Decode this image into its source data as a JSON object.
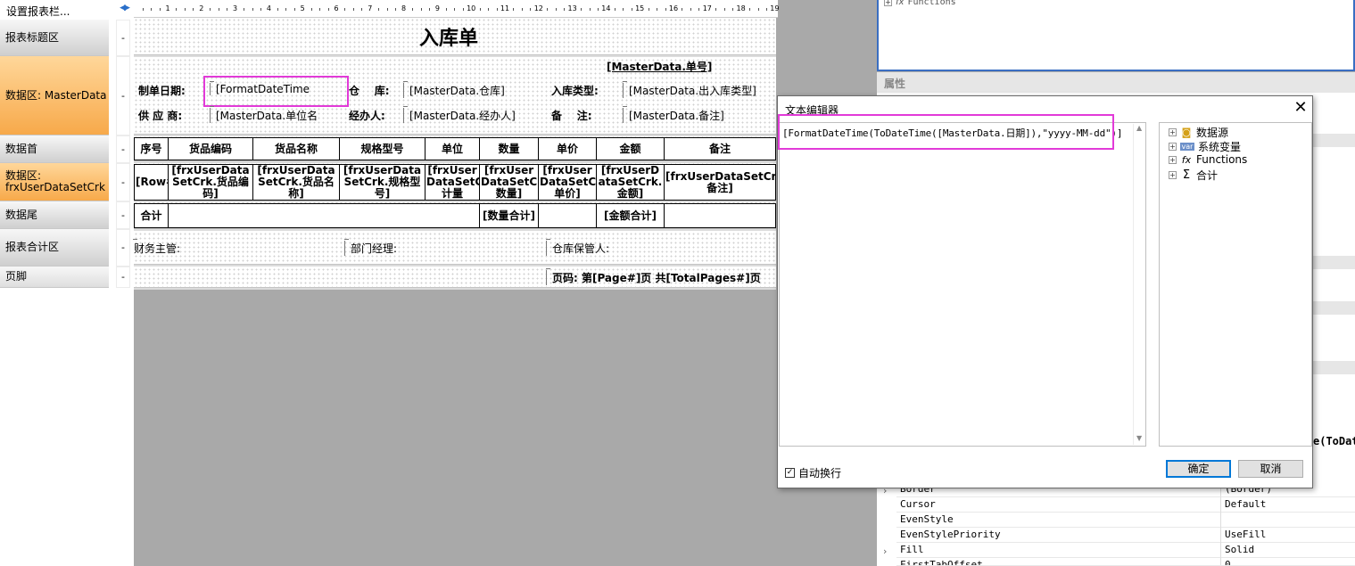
{
  "band_list": {
    "header": "设置报表栏...",
    "bands": [
      {
        "label": "报表标题区"
      },
      {
        "label": "数据区: MasterData"
      },
      {
        "label": "数据首"
      },
      {
        "label": "数据区:\nfrxUserDataSetCrk"
      },
      {
        "label": "数据尾"
      },
      {
        "label": "报表合计区"
      },
      {
        "label": "页脚"
      }
    ],
    "collapse_glyph": "◀▶",
    "band_marker": "-"
  },
  "ruler": {
    "ticks": [
      "1",
      "2",
      "3",
      "4",
      "5",
      "6",
      "7",
      "8",
      "9",
      "10",
      "11",
      "12",
      "13",
      "14",
      "15",
      "16",
      "17",
      "18",
      "19"
    ]
  },
  "report": {
    "title": "入库单",
    "order_no": "[MasterData.单号]",
    "make_date_label": "制单日期:",
    "make_date_value": "[FormatDateTime",
    "warehouse_label": "仓    库:",
    "warehouse_value": "[MasterData.仓库]",
    "in_type_label": "入库类型:",
    "in_type_value": "[MasterData.出入库类型]",
    "supplier_label": "供 应 商:",
    "supplier_value": "[MasterData.单位名",
    "handler_label": "经办人:",
    "handler_value": "[MasterData.经办人]",
    "remark_label": "备    注:",
    "remark_value": "[MasterData.备注]",
    "table_headers": [
      "序号",
      "货品编码",
      "货品名称",
      "规格型号",
      "单位",
      "数量",
      "单价",
      "金额",
      "备注"
    ],
    "detail_row": [
      "[Row#]",
      "[frxUserData SetCrk.货品编码]",
      "[frxUserData SetCrk.货品名称]",
      "[frxUserData SetCrk.规格型号]",
      "[frxUser DataSetCrk.计量",
      "[frxUser DataSetCrk.数量]",
      "[frxUser DataSetCrk.单价]",
      "[frxUserD ataSetCrk.金额]",
      "[frxUserDataSetCrk.备注]"
    ],
    "total_label": "合计",
    "total_qty": "[数量合计]",
    "total_amount": "[金额合计]",
    "finance_label": "财务主管:",
    "dept_label": "部门经理:",
    "keeper_label": "仓库保管人:",
    "page_footer": "页码: 第[Page#]页 共[TotalPages#]页"
  },
  "right_panel": {
    "top_tree_item": "Functions",
    "top_tree_icon": "fx",
    "section_title": "属性",
    "partial_value": "e(ToDat",
    "properties": [
      {
        "name": "Border",
        "value": "(Border)"
      },
      {
        "name": "Cursor",
        "value": "Default"
      },
      {
        "name": "EvenStyle",
        "value": ""
      },
      {
        "name": "EvenStylePriority",
        "value": "UseFill"
      },
      {
        "name": "Fill",
        "value": "Solid"
      },
      {
        "name": "FirstTabOffset",
        "value": "0"
      }
    ]
  },
  "dialog": {
    "title": "文本编辑器",
    "close_glyph": "✕",
    "expression": "[FormatDateTime(ToDateTime([MasterData.日期]),\"yyyy-MM-dd\")]",
    "tree": [
      {
        "label": "数据源",
        "icon": "database-icon"
      },
      {
        "label": "系统变量",
        "icon": "var-icon",
        "icon_text": "var"
      },
      {
        "label": "Functions",
        "icon": "function-icon",
        "icon_text": "fx"
      },
      {
        "label": "合计",
        "icon": "sigma-icon",
        "icon_text": "Σ"
      }
    ],
    "word_wrap_label": "自动换行",
    "word_wrap_checked": true,
    "ok_label": "确定",
    "cancel_label": "取消"
  },
  "colors": {
    "highlight": "#e23ad8",
    "band_orange": "#f7a94a",
    "panel_border": "#3a6ec2",
    "button_focus": "#0078d7"
  }
}
